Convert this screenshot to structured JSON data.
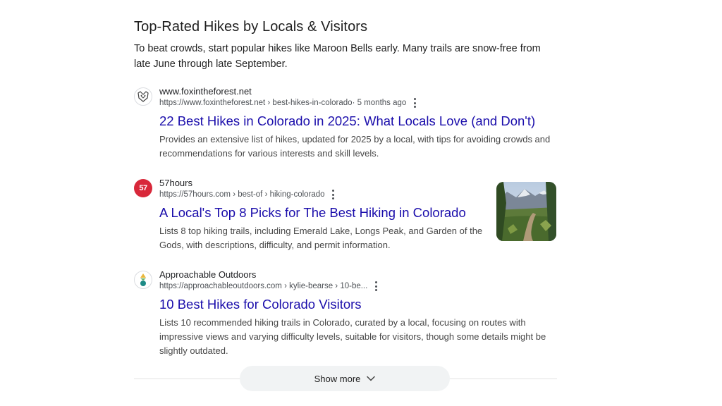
{
  "section": {
    "title": "Top-Rated Hikes by Locals & Visitors",
    "intro": "To beat crowds, start popular hikes like Maroon Bells early. Many trails are snow-free from late June through late September."
  },
  "results": [
    {
      "site_name": "www.foxintheforest.net",
      "url": "https://www.foxintheforest.net › best-hikes-in-colorado",
      "age": " ·  5 months ago",
      "title": "22 Best Hikes in Colorado in 2025: What Locals Love (and Don't)",
      "snippet": "Provides an extensive list of hikes, updated for 2025 by a local, with tips for avoiding crowds and recommendations for various interests and skill levels.",
      "favicon": "fox-logo-icon"
    },
    {
      "site_name": "57hours",
      "url": "https://57hours.com › best-of › hiking-colorado",
      "title": "A Local's Top 8 Picks for The Best Hiking in Colorado",
      "snippet": "Lists 8 top hiking trails, including Emerald Lake, Longs Peak, and Garden of the Gods, with descriptions, difficulty, and permit information.",
      "favicon_text": "57",
      "favicon_color": "#d8283a",
      "thumbnail": "mountain-trail-thumbnail"
    },
    {
      "site_name": "Approachable Outdoors",
      "url": "https://approachableoutdoors.com › kylie-bearse › 10-be...",
      "title": "10 Best Hikes for Colorado Visitors",
      "snippet": "Lists 10 recommended hiking trails in Colorado, curated by a local, focusing on routes with impressive views and varying difficulty levels, suitable for visitors, though some details might be slightly outdated.",
      "favicon": "approachable-outdoors-logo-icon"
    }
  ],
  "show_more": {
    "label": "Show more",
    "icon": "chevron-down-icon"
  },
  "colors": {
    "link": "#1a0dab",
    "muted_text": "#4d5156",
    "button_bg": "#f1f3f4"
  }
}
